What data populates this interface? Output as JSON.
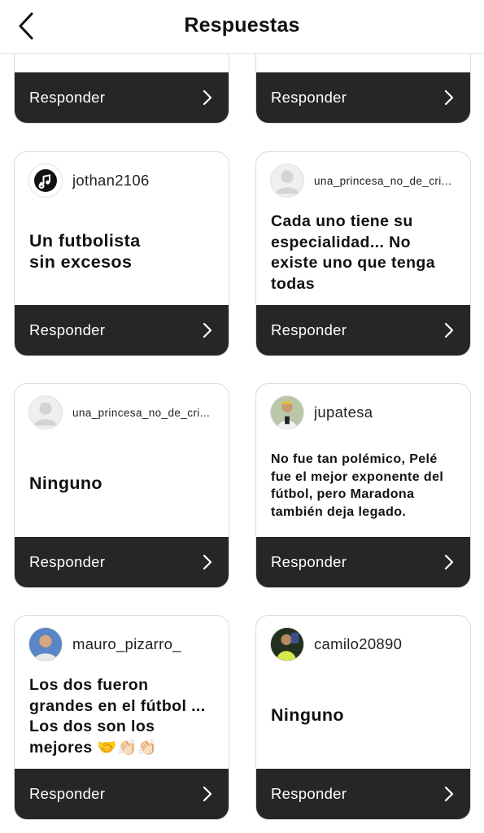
{
  "header": {
    "title": "Respuestas",
    "back_icon": "chevron-left-icon"
  },
  "reply_button_label": "Responder",
  "cards": [
    {
      "username": "",
      "text": ""
    },
    {
      "username": "",
      "text": ""
    },
    {
      "username": "jothan2106",
      "text": "Un futbolista sin excesos"
    },
    {
      "username": "una_princesa_no_de_cri...",
      "text": "Cada uno tiene su especialidad... No existe uno que tenga todas"
    },
    {
      "username": "una_princesa_no_de_cri...",
      "text": "Ninguno"
    },
    {
      "username": "jupatesa",
      "text": "No fue tan polémico, Pelé fue el mejor exponente del fútbol, pero Maradona también deja legado."
    },
    {
      "username": "mauro_pizarro_",
      "text": "Los dos fueron grandes en el fútbol ... Los dos son los mejores 🤝👏🏻👏🏻"
    },
    {
      "username": "camilo20890",
      "text": "Ninguno"
    }
  ]
}
